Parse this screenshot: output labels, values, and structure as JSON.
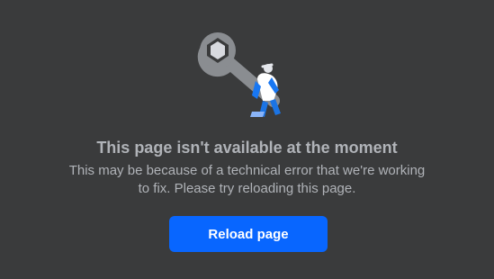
{
  "error": {
    "illustration_icon": "wrench-with-person-icon",
    "title": "This page isn't available at the moment",
    "message_line1": "This may be because of a technical error that we're working",
    "message_line2": "to fix. Please try reloading this page.",
    "reload_label": "Reload page"
  },
  "colors": {
    "background": "#3a3b3c",
    "text": "#b0b3b8",
    "button": "#0866ff",
    "button_text": "#ffffff"
  }
}
